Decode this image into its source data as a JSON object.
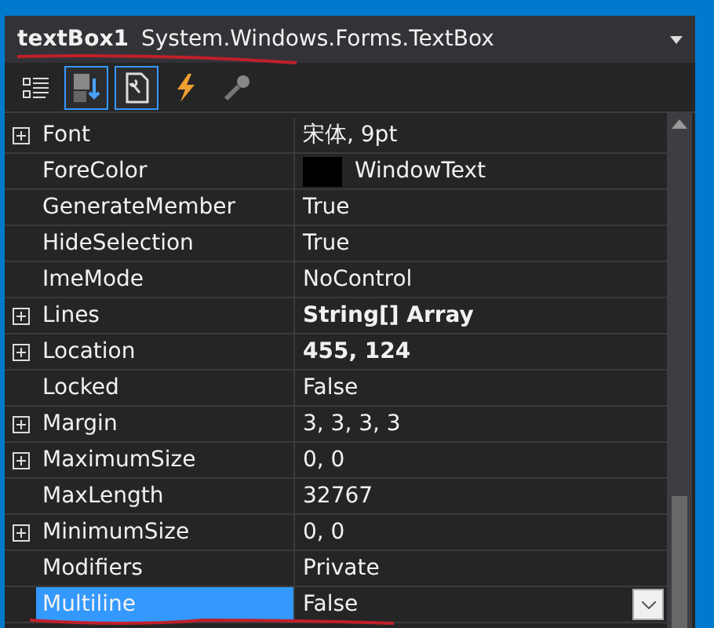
{
  "object_selector": {
    "name": "textBox1",
    "type": "System.Windows.Forms.TextBox"
  },
  "toolbar": [
    {
      "kind": "categorized",
      "selected": false
    },
    {
      "kind": "alphabetical",
      "selected": true
    },
    {
      "kind": "properties",
      "selected": true
    },
    {
      "kind": "events",
      "selected": false
    },
    {
      "kind": "pages",
      "selected": false
    }
  ],
  "properties": [
    {
      "name": "Font",
      "value": "宋体, 9pt",
      "expandable": true,
      "bold": false,
      "selected": false
    },
    {
      "name": "ForeColor",
      "value": "WindowText",
      "expandable": false,
      "bold": false,
      "selected": false,
      "color": "#000000"
    },
    {
      "name": "GenerateMember",
      "value": "True",
      "expandable": false,
      "bold": false,
      "selected": false
    },
    {
      "name": "HideSelection",
      "value": "True",
      "expandable": false,
      "bold": false,
      "selected": false
    },
    {
      "name": "ImeMode",
      "value": "NoControl",
      "expandable": false,
      "bold": false,
      "selected": false
    },
    {
      "name": "Lines",
      "value": "String[] Array",
      "expandable": true,
      "bold": true,
      "selected": false
    },
    {
      "name": "Location",
      "value": "455, 124",
      "expandable": true,
      "bold": true,
      "selected": false
    },
    {
      "name": "Locked",
      "value": "False",
      "expandable": false,
      "bold": false,
      "selected": false
    },
    {
      "name": "Margin",
      "value": "3, 3, 3, 3",
      "expandable": true,
      "bold": false,
      "selected": false
    },
    {
      "name": "MaximumSize",
      "value": "0, 0",
      "expandable": true,
      "bold": false,
      "selected": false
    },
    {
      "name": "MaxLength",
      "value": "32767",
      "expandable": false,
      "bold": false,
      "selected": false
    },
    {
      "name": "MinimumSize",
      "value": "0, 0",
      "expandable": true,
      "bold": false,
      "selected": false
    },
    {
      "name": "Modifiers",
      "value": "Private",
      "expandable": false,
      "bold": false,
      "selected": false
    },
    {
      "name": "Multiline",
      "value": "False",
      "expandable": false,
      "bold": false,
      "selected": true
    }
  ]
}
